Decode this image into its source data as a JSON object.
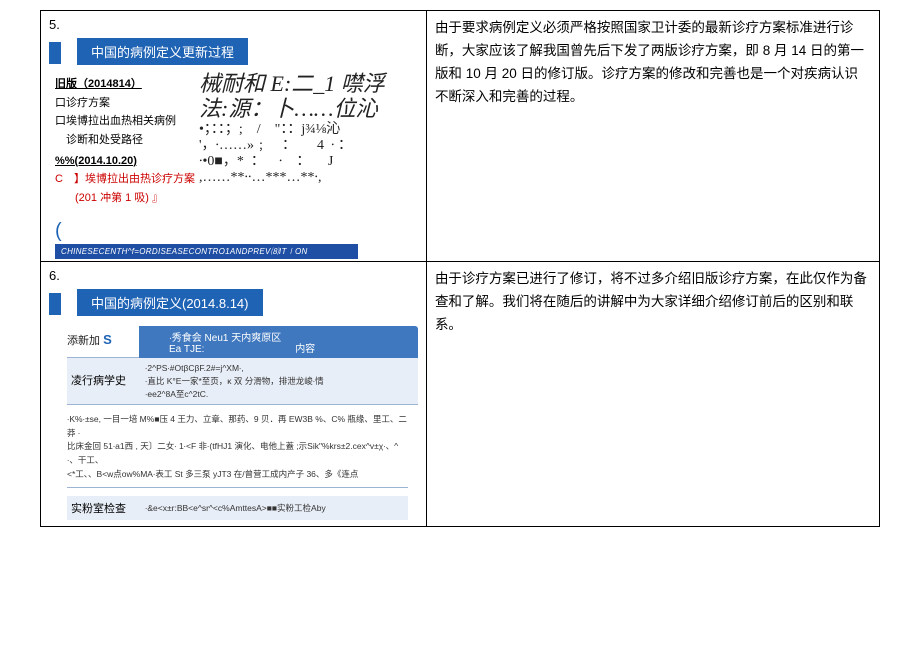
{
  "row5": {
    "num": "5.",
    "banner": "中国的病例定义更新过程",
    "leftblock": {
      "hdr": "旧版（2014814）",
      "li1": "口诊疗方案",
      "li2": "口埃博拉出血热相关病例",
      "li3": "　诊断和处受路径",
      "date2": "%%(2014.10.20)",
      "red1": "C　】埃博拉出由热诊疗方案",
      "red2": "(201 冲第 1 吸) 』"
    },
    "rightart": {
      "l1": "械耐和 E:二_1 噤浮",
      "l2": "法:源：卜……位沁",
      "l3": "•；：：；;　/　\"：：j¾⅛沁",
      "l4": "'，∙……»﹔　：　　4  ∙ ：",
      "l5": "∙•0■，*  ：    ∙    ：     J",
      "l6": ",……**∙∙…***…**∙,"
    },
    "footer": "CHINESECENTH^f=ORDISEASECONTRO1ANDPREV⑻IT∣ON",
    "explain": "由于要求病例定义必须严格按照国家卫计委的最新诊疗方案标准进行诊断，大家应该了解我国曾先后下发了两版诊疗方案，即 8 月 14 日的第一版和 10 月 20 日的修订版。诊疗方案的修改和完善也是一个对疾病认识不断深入和完善的过程。"
  },
  "row6": {
    "num": "6.",
    "banner": "中国的病例定义(2014.8.14)",
    "row1": {
      "lab_pre": "添新加",
      "lab_s": "S",
      "h1": "∙秀食会 Neu1 天内爽原区Ea TJE:",
      "h2": "内容"
    },
    "row2": {
      "lab": "凌行病学史",
      "b1": "∙2^PS∙#OtβCβF.2#=j^XM∙,",
      "b2": "∙直比 Κ°E一家*至页，κ 双 分滑物，排泄龙峻∙情",
      "b3": "∙ee2^8A至c^2tC."
    },
    "para": "∙K%∙±se, 一目一培 M%■压 4 王力、立章、那药、9 贝．再 EW3B %、C% 瓶缘、里工、二莽 ∙\n比床金回 51∙a1西 , 天〕二女∙ 1∙<F 非∙(tfHJ1 演化、电他上蓋 ;示Sik\"%krs±2.cex^v±χ∙、^ ∙、干工、\n<*工、、B<w点ow%MA∙表工 St 多三泵 yJT3 在/曾营工成内产子 36、多《连点",
    "row3": {
      "lab": "实粉室检查",
      "body": "∙&e<x±r:BB<e^sr^<c%AmttesA>■■实粉工检Aby"
    },
    "explain": "由于诊疗方案已进行了修订，将不过多介绍旧版诊疗方案，在此仅作为备查和了解。我们将在随后的讲解中为大家详细介绍修订前后的区别和联系。"
  }
}
